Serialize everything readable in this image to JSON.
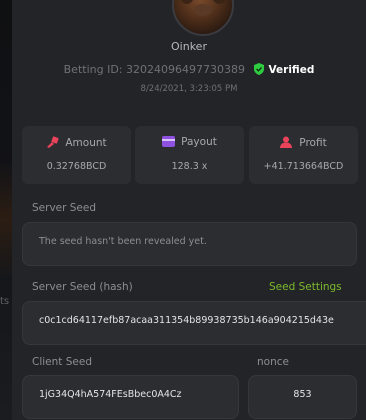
{
  "user": {
    "name": "Oinker"
  },
  "bet": {
    "id_label": "Betting ID:",
    "id_value": "32024096497730389",
    "verified_label": "Verified",
    "date": "8/24/2021, 3:23:05 PM"
  },
  "stats": [
    {
      "label": "Amount",
      "value": "0.32768BCD",
      "icon": "coins-icon",
      "color": "#e8435a"
    },
    {
      "label": "Payout",
      "value": "128.3 x",
      "icon": "wallet-icon",
      "color": "#8f52e0"
    },
    {
      "label": "Profit",
      "value": "+41.713664BCD",
      "icon": "user-profit-icon",
      "color": "#e8435a"
    }
  ],
  "server_seed": {
    "label": "Server Seed",
    "value": "The seed hasn't been revealed yet."
  },
  "server_seed_hash": {
    "label": "Server Seed (hash)",
    "settings_link": "Seed Settings",
    "value": "c0c1cd64117efb87acaa311354b89938735b146a904215d43e"
  },
  "client_seed": {
    "label": "Client Seed",
    "value": "1jG34Q4hA574FEsBbec0A4Cz"
  },
  "nonce": {
    "label": "nonce",
    "value": "853"
  },
  "colors": {
    "accent_green": "#7cbb2c",
    "verified_shield": "#2ecc40",
    "background": "#232427",
    "card": "#2c2d31"
  }
}
